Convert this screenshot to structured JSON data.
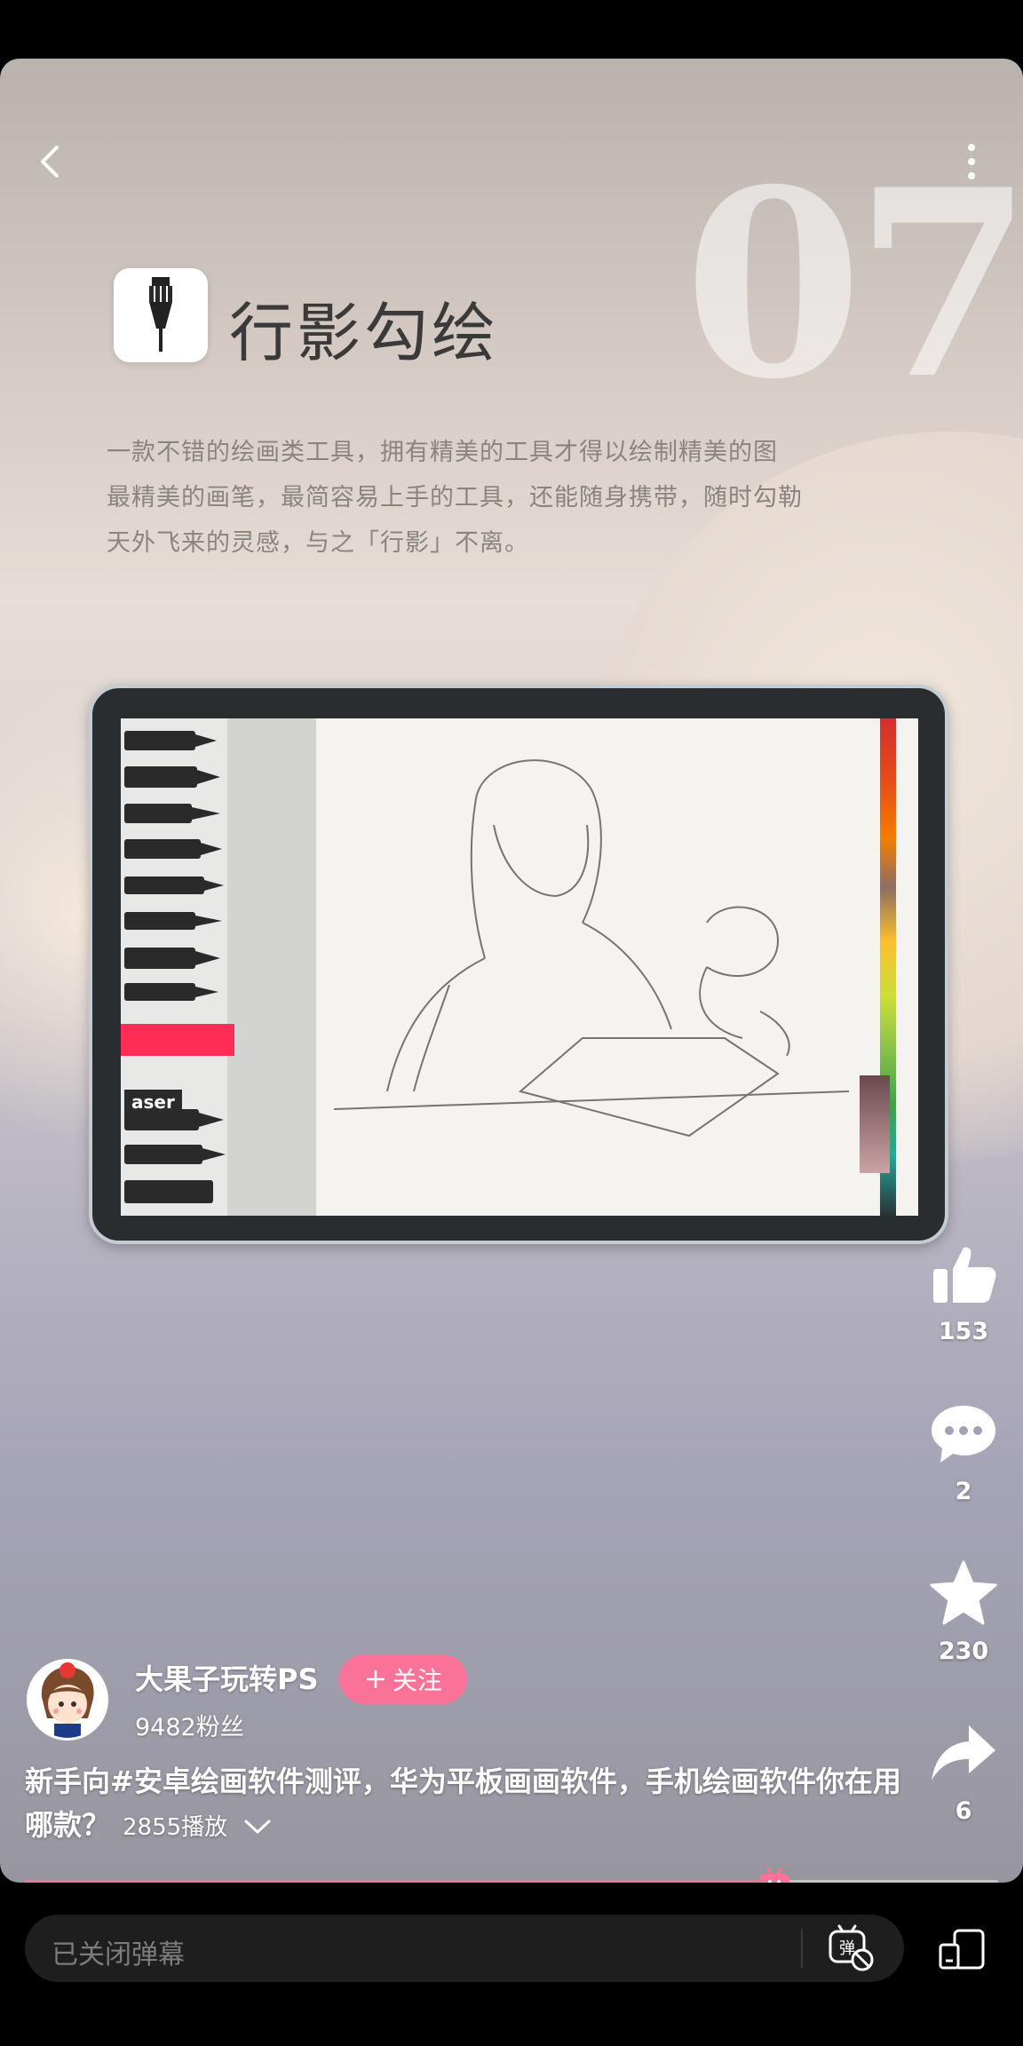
{
  "app": {
    "accent_color": "#fb7299"
  },
  "video": {
    "slide_number": "07",
    "app_name": "行影勾绘",
    "description_lines": [
      "一款不错的绘画类工具，拥有精美的工具才得以绘制精美的图",
      "最精美的画笔，最简容易上手的工具，还能随身携带，随时勾勒",
      "天外飞来的灵感，与之「行影」不离。"
    ],
    "eraser_text": "aser"
  },
  "top_bar": {
    "back_icon": "chevron-left-icon",
    "more_icon": "more-vertical-icon"
  },
  "actions": {
    "like": {
      "icon": "thumbs-up-icon",
      "count": "153"
    },
    "comment": {
      "icon": "comment-icon",
      "count": "2"
    },
    "favorite": {
      "icon": "star-icon",
      "count": "230"
    },
    "share": {
      "icon": "share-icon",
      "count": "6"
    }
  },
  "author": {
    "name": "大果子玩转PS",
    "fans": "9482粉丝",
    "follow_label": "关注"
  },
  "title": {
    "text": "新手向#安卓绘画软件测评，华为平板画画软件，手机绘画软件你在用哪款？",
    "play_count": "2855播放"
  },
  "progress": {
    "fraction": 0.77
  },
  "bottom": {
    "danmaku_placeholder": "已关闭弹幕",
    "danmaku_toggle_icon": "danmaku-off-icon",
    "screen_mode_icon": "screen-mode-icon"
  }
}
